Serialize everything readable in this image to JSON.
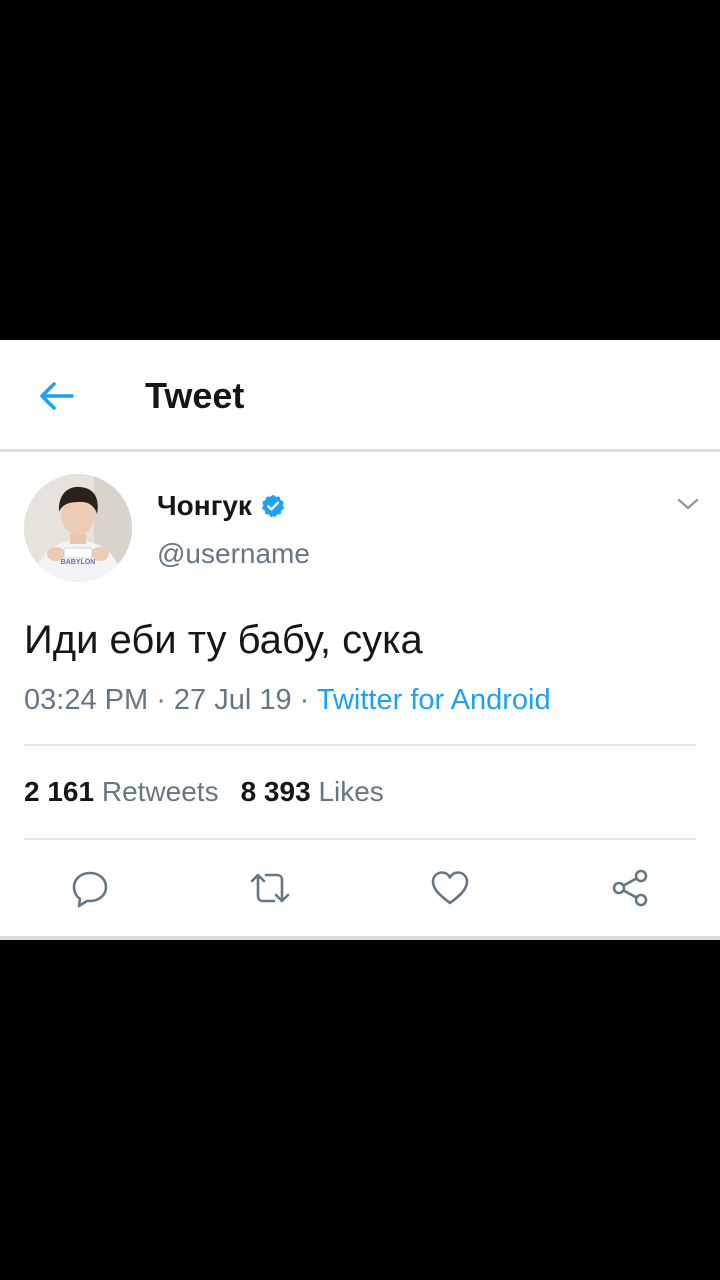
{
  "header": {
    "title": "Tweet",
    "back_icon": "arrow-left-icon"
  },
  "tweet": {
    "author": {
      "display_name": "Чонгук",
      "handle": "@username",
      "verified": true,
      "avatar_shirt_text": "BABYLON"
    },
    "text": "Иди еби ту бабу, сука",
    "time": "03:24 PM",
    "separator": " · ",
    "date": "27 Jul 19",
    "source": "Twitter for Android"
  },
  "stats": {
    "retweets_count": "2 161",
    "retweets_label": "Retweets",
    "likes_count": "8 393",
    "likes_label": "Likes"
  },
  "actions": [
    {
      "icon": "reply-icon"
    },
    {
      "icon": "retweet-icon"
    },
    {
      "icon": "heart-icon"
    },
    {
      "icon": "share-icon"
    }
  ],
  "colors": {
    "accent": "#1da1f2",
    "text_primary": "#14171a",
    "text_secondary": "#657786",
    "divider": "#e1e8ed",
    "background": "#ffffff",
    "letterbox": "#000000"
  }
}
